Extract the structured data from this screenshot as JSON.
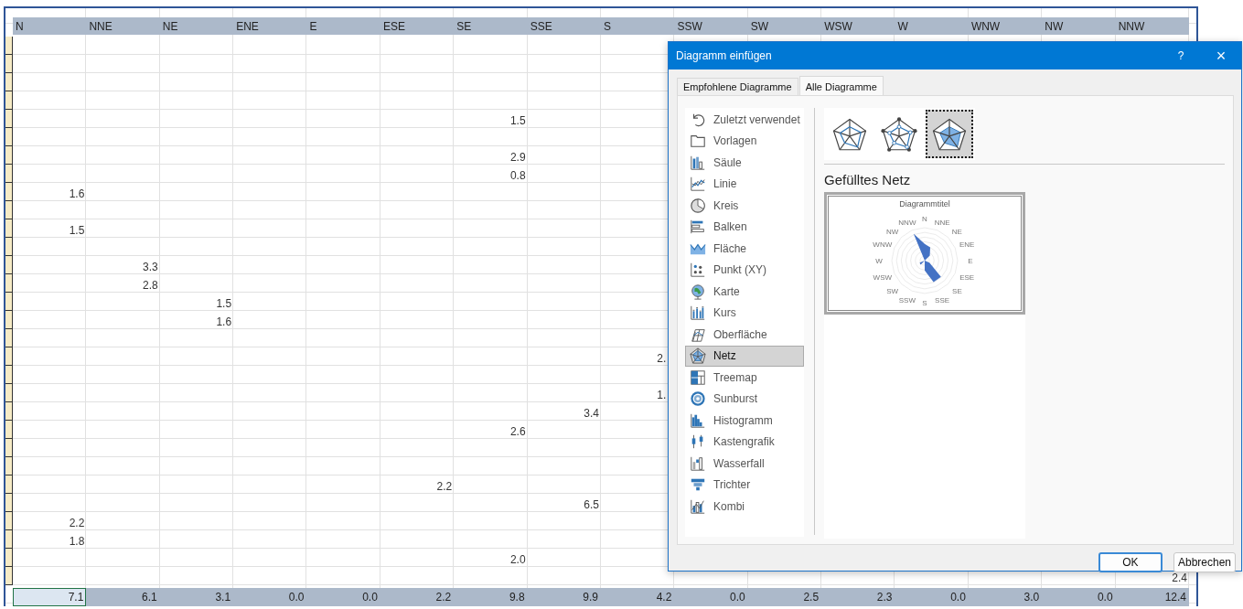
{
  "sheet": {
    "columns": [
      "N",
      "NNE",
      "NE",
      "ENE",
      "E",
      "ESE",
      "SE",
      "SSE",
      "S",
      "SSW",
      "SW",
      "WSW",
      "W",
      "WNW",
      "NW",
      "NNW"
    ],
    "rows": [
      [
        null,
        null,
        null,
        null,
        null,
        null,
        null,
        null,
        null,
        null,
        null,
        null,
        null,
        null,
        null,
        null
      ],
      [
        null,
        null,
        null,
        null,
        null,
        null,
        null,
        null,
        null,
        null,
        null,
        null,
        null,
        null,
        null,
        null
      ],
      [
        null,
        null,
        null,
        null,
        null,
        null,
        null,
        null,
        null,
        null,
        null,
        null,
        null,
        null,
        null,
        null
      ],
      [
        null,
        null,
        null,
        null,
        null,
        null,
        null,
        null,
        null,
        null,
        null,
        null,
        null,
        null,
        null,
        null
      ],
      [
        null,
        null,
        null,
        null,
        null,
        null,
        "1.5",
        null,
        null,
        null,
        null,
        null,
        null,
        null,
        null,
        null
      ],
      [
        null,
        null,
        null,
        null,
        null,
        null,
        null,
        null,
        null,
        null,
        null,
        null,
        null,
        null,
        null,
        null
      ],
      [
        null,
        null,
        null,
        null,
        null,
        null,
        "2.9",
        null,
        null,
        null,
        null,
        null,
        null,
        null,
        null,
        null
      ],
      [
        null,
        null,
        null,
        null,
        null,
        null,
        "0.8",
        null,
        null,
        null,
        null,
        null,
        null,
        null,
        null,
        null
      ],
      [
        "1.6",
        null,
        null,
        null,
        null,
        null,
        null,
        null,
        null,
        null,
        null,
        null,
        null,
        null,
        null,
        null
      ],
      [
        null,
        null,
        null,
        null,
        null,
        null,
        null,
        null,
        null,
        null,
        null,
        null,
        null,
        null,
        null,
        null
      ],
      [
        "1.5",
        null,
        null,
        null,
        null,
        null,
        null,
        null,
        null,
        null,
        null,
        null,
        null,
        null,
        null,
        null
      ],
      [
        null,
        null,
        null,
        null,
        null,
        null,
        null,
        null,
        null,
        null,
        null,
        null,
        null,
        null,
        null,
        null
      ],
      [
        null,
        "3.3",
        null,
        null,
        null,
        null,
        null,
        null,
        null,
        null,
        null,
        null,
        null,
        null,
        null,
        null
      ],
      [
        null,
        "2.8",
        null,
        null,
        null,
        null,
        null,
        null,
        null,
        null,
        null,
        null,
        null,
        null,
        null,
        null
      ],
      [
        null,
        null,
        "1.5",
        null,
        null,
        null,
        null,
        null,
        null,
        null,
        null,
        null,
        null,
        null,
        null,
        null
      ],
      [
        null,
        null,
        "1.6",
        null,
        null,
        null,
        null,
        null,
        null,
        null,
        null,
        null,
        null,
        null,
        null,
        null
      ],
      [
        null,
        null,
        null,
        null,
        null,
        null,
        null,
        null,
        null,
        null,
        null,
        null,
        null,
        null,
        null,
        null
      ],
      [
        null,
        null,
        null,
        null,
        null,
        null,
        null,
        null,
        "2.",
        null,
        null,
        null,
        null,
        null,
        null,
        null
      ],
      [
        null,
        null,
        null,
        null,
        null,
        null,
        null,
        null,
        null,
        null,
        null,
        null,
        null,
        null,
        null,
        null
      ],
      [
        null,
        null,
        null,
        null,
        null,
        null,
        null,
        null,
        "1.",
        null,
        null,
        null,
        null,
        null,
        null,
        null
      ],
      [
        null,
        null,
        null,
        null,
        null,
        null,
        null,
        "3.4",
        null,
        null,
        null,
        null,
        null,
        null,
        null,
        null
      ],
      [
        null,
        null,
        null,
        null,
        null,
        null,
        "2.6",
        null,
        null,
        null,
        null,
        null,
        null,
        null,
        null,
        null
      ],
      [
        null,
        null,
        null,
        null,
        null,
        null,
        null,
        null,
        null,
        null,
        null,
        null,
        null,
        null,
        null,
        null
      ],
      [
        null,
        null,
        null,
        null,
        null,
        null,
        null,
        null,
        null,
        null,
        null,
        null,
        null,
        null,
        null,
        null
      ],
      [
        null,
        null,
        null,
        null,
        null,
        "2.2",
        null,
        null,
        null,
        null,
        null,
        null,
        null,
        null,
        null,
        null
      ],
      [
        null,
        null,
        null,
        null,
        null,
        null,
        null,
        "6.5",
        null,
        null,
        null,
        null,
        null,
        null,
        null,
        null
      ],
      [
        "2.2",
        null,
        null,
        null,
        null,
        null,
        null,
        null,
        null,
        null,
        null,
        null,
        null,
        null,
        null,
        null
      ],
      [
        "1.8",
        null,
        null,
        null,
        null,
        null,
        null,
        null,
        null,
        null,
        null,
        null,
        null,
        null,
        null,
        null
      ],
      [
        null,
        null,
        null,
        null,
        null,
        null,
        "2.0",
        null,
        null,
        null,
        null,
        null,
        null,
        null,
        null,
        null
      ],
      [
        null,
        null,
        null,
        null,
        null,
        null,
        null,
        null,
        null,
        null,
        null,
        null,
        null,
        null,
        null,
        "2.4"
      ]
    ],
    "totals": [
      {
        "value": "7.1",
        "selected": true
      },
      {
        "value": "6.1",
        "selected": false
      },
      {
        "value": "3.1",
        "selected": false
      },
      {
        "value": "0.0",
        "selected": false
      },
      {
        "value": "0.0",
        "selected": false
      },
      {
        "value": "2.2",
        "selected": false
      },
      {
        "value": "9.8",
        "selected": false
      },
      {
        "value": "9.9",
        "selected": false
      },
      {
        "value": "4.2",
        "selected": false
      },
      {
        "value": "0.0",
        "selected": false
      },
      {
        "value": "2.5",
        "selected": false
      },
      {
        "value": "2.3",
        "selected": false
      },
      {
        "value": "0.0",
        "selected": false
      },
      {
        "value": "3.0",
        "selected": false
      },
      {
        "value": "0.0",
        "selected": false
      },
      {
        "value": "12.4",
        "selected": false
      }
    ]
  },
  "dialog": {
    "title": "Diagramm einfügen",
    "help": "?",
    "close": "×",
    "tabs": [
      {
        "label": "Empfohlene Diagramme",
        "selected": false
      },
      {
        "label": "Alle Diagramme",
        "selected": true
      }
    ],
    "chart_types": [
      {
        "label": "Zuletzt verwendet",
        "selected": false
      },
      {
        "label": "Vorlagen",
        "selected": false
      },
      {
        "label": "Säule",
        "selected": false
      },
      {
        "label": "Linie",
        "selected": false
      },
      {
        "label": "Kreis",
        "selected": false
      },
      {
        "label": "Balken",
        "selected": false
      },
      {
        "label": "Fläche",
        "selected": false
      },
      {
        "label": "Punkt (XY)",
        "selected": false
      },
      {
        "label": "Karte",
        "selected": false
      },
      {
        "label": "Kurs",
        "selected": false
      },
      {
        "label": "Oberfläche",
        "selected": false
      },
      {
        "label": "Netz",
        "selected": true
      },
      {
        "label": "Treemap",
        "selected": false
      },
      {
        "label": "Sunburst",
        "selected": false
      },
      {
        "label": "Histogramm",
        "selected": false
      },
      {
        "label": "Kastengrafik",
        "selected": false
      },
      {
        "label": "Wasserfall",
        "selected": false
      },
      {
        "label": "Trichter",
        "selected": false
      },
      {
        "label": "Kombi",
        "selected": false
      }
    ],
    "subtypes": [
      {
        "selected": false
      },
      {
        "selected": false
      },
      {
        "selected": true
      }
    ],
    "subtype_title": "Gefülltes Netz",
    "preview": {
      "title": "Diagrammtitel",
      "axis_labels_right": [
        "N",
        "NNE",
        "NE",
        "ENE",
        "E",
        "ESE",
        "SE",
        "SSE",
        "S"
      ],
      "axis_labels_left": [
        "NNW",
        "NW",
        "WNW",
        "W",
        "WSW",
        "SW",
        "SSW"
      ]
    },
    "buttons": [
      {
        "label": "OK",
        "default": true
      },
      {
        "label": "Abbrechen",
        "default": false
      }
    ]
  }
}
